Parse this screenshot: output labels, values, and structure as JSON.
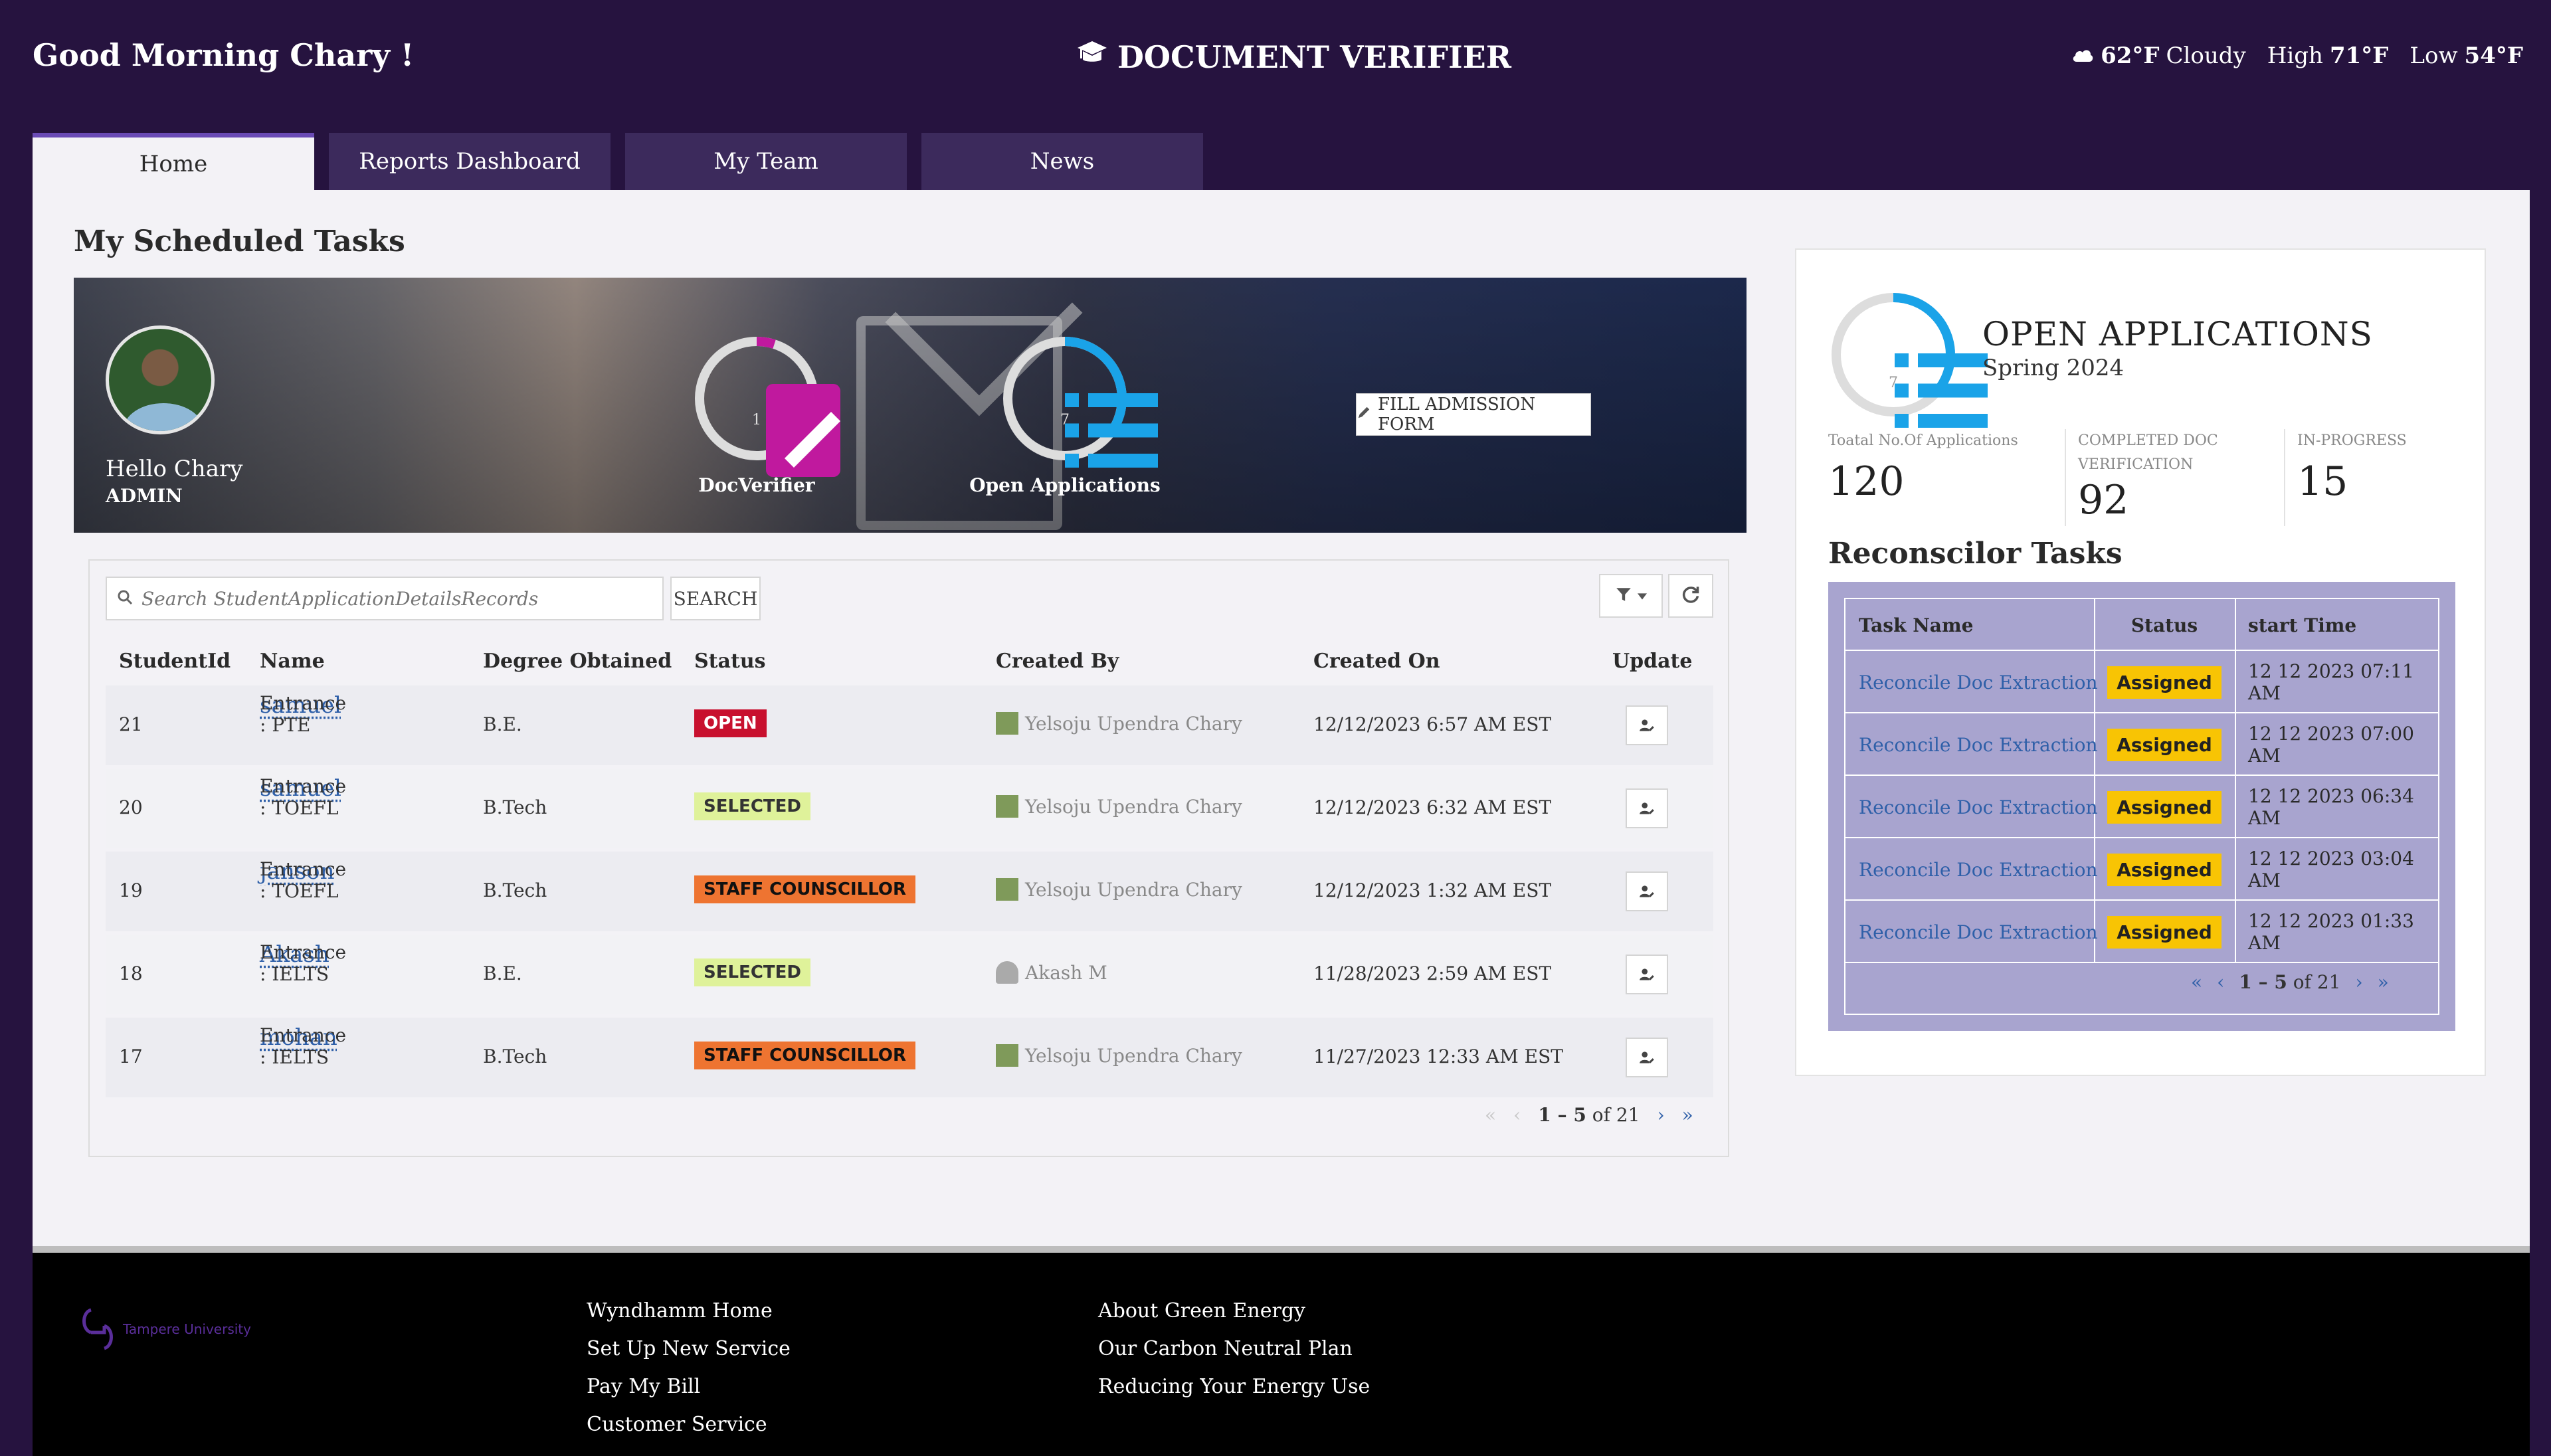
{
  "header": {
    "greeting": "Good Morning Chary !",
    "app_title": "DOCUMENT VERIFIER",
    "weather": {
      "current_temp": "62°F",
      "condition": "Cloudy",
      "high_label": "High",
      "high": "71°F",
      "low_label": "Low",
      "low": "54°F"
    }
  },
  "tabs": [
    {
      "label": "Home",
      "active": true
    },
    {
      "label": "Reports Dashboard",
      "active": false
    },
    {
      "label": "My Team",
      "active": false
    },
    {
      "label": "News",
      "active": false
    }
  ],
  "main": {
    "section_title": "My Scheduled Tasks",
    "banner": {
      "hello": "Hello Chary",
      "role": "ADMIN",
      "doc_verifier": {
        "label": "DocVerifier",
        "count": "1",
        "ring_fraction": 0.05,
        "ring_color": "#c0199e"
      },
      "open_applications": {
        "label": "Open Applications",
        "count": "7",
        "ring_fraction": 0.35,
        "ring_color": "#1aa3e8"
      },
      "fill_form_button": "FILL ADMISSION FORM"
    },
    "search": {
      "placeholder": "Search StudentApplicationDetailsRecords",
      "button": "SEARCH"
    },
    "table": {
      "columns": [
        "StudentId",
        "Name",
        "Degree Obtained",
        "Status",
        "Created By",
        "Created On",
        "Update"
      ],
      "rows": [
        {
          "id": "21",
          "name": "samuel",
          "entrance": "Entrance : PTE",
          "degree": "B.E.",
          "status": "OPEN",
          "status_type": "open",
          "created_by": "Yelsoju Upendra Chary",
          "created_on": "12/12/2023 6:57 AM EST"
        },
        {
          "id": "20",
          "name": "samuel",
          "entrance": "Entrance : TOEFL",
          "degree": "B.Tech",
          "status": "SELECTED",
          "status_type": "selected",
          "created_by": "Yelsoju Upendra Chary",
          "created_on": "12/12/2023 6:32 AM EST"
        },
        {
          "id": "19",
          "name": "janson",
          "entrance": "Entrance : TOEFL",
          "degree": "B.Tech",
          "status": "STAFF COUNSCILLOR",
          "status_type": "staff",
          "created_by": "Yelsoju Upendra Chary",
          "created_on": "12/12/2023 1:32 AM EST"
        },
        {
          "id": "18",
          "name": "Akash",
          "entrance": "Entrance : IELTS",
          "degree": "B.E.",
          "status": "SELECTED",
          "status_type": "selected",
          "created_by": "Akash M",
          "created_on": "11/28/2023 2:59 AM EST"
        },
        {
          "id": "17",
          "name": "mohan",
          "entrance": "Entrance : IELTS",
          "degree": "B.Tech",
          "status": "STAFF COUNSCILLOR",
          "status_type": "staff",
          "created_by": "Yelsoju Upendra Chary",
          "created_on": "11/27/2023 12:33 AM EST"
        }
      ]
    },
    "pager": {
      "range": "1 – 5",
      "of_label": "of 21"
    }
  },
  "side": {
    "open_apps": {
      "title": "OPEN APPLICATIONS",
      "subtitle": "Spring 2024",
      "count": "7",
      "ring_fraction": 0.35,
      "ring_color": "#1aa3e8"
    },
    "stats": [
      {
        "label": "Toatal No.Of Applications",
        "value": "120"
      },
      {
        "label": "COMPLETED DOC VERIFICATION",
        "value": "92"
      },
      {
        "label": "IN-PROGRESS",
        "value": "15"
      }
    ],
    "reconcilor": {
      "title": "Reconscilor Tasks",
      "columns": [
        "Task Name",
        "Status",
        "start Time"
      ],
      "rows": [
        {
          "task": "Reconcile Doc Extraction",
          "status": "Assigned",
          "time": "12 12 2023 07:11 AM"
        },
        {
          "task": "Reconcile Doc Extraction",
          "status": "Assigned",
          "time": "12 12 2023 07:00 AM"
        },
        {
          "task": "Reconcile Doc Extraction",
          "status": "Assigned",
          "time": "12 12 2023 06:34 AM"
        },
        {
          "task": "Reconcile Doc Extraction",
          "status": "Assigned",
          "time": "12 12 2023 03:04 AM"
        },
        {
          "task": "Reconcile Doc Extraction",
          "status": "Assigned",
          "time": "12 12 2023 01:33 AM"
        }
      ],
      "pager": {
        "range": "1 – 5",
        "of_label": "of 21"
      }
    }
  },
  "footer": {
    "logo_text": "Tampere University",
    "col1": [
      "Wyndhamm Home",
      "Set Up New Service",
      "Pay My Bill",
      "Customer Service"
    ],
    "col2": [
      "About Green Energy",
      "Our Carbon Neutral Plan",
      "Reducing Your Energy Use"
    ]
  },
  "colors": {
    "header_bg": "#26133f",
    "tab_active_border": "#6a4bb5",
    "link": "#2e5fa8",
    "open_badge": "#c8102e",
    "selected_badge": "#dff29a",
    "staff_badge": "#ee7431",
    "assigned_badge": "#f8c404",
    "reconcilor_bg": "#a8a4cf"
  }
}
